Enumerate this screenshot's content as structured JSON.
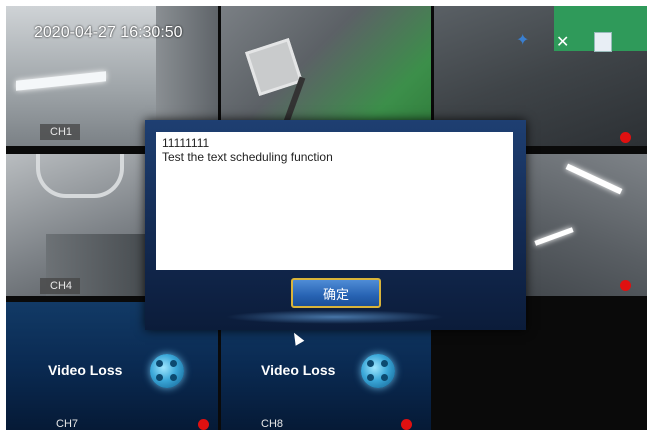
{
  "timestamp": "2020-04-27 16:30:50",
  "channels": {
    "ch1": "CH1",
    "ch4": "CH4",
    "ch7": "CH7",
    "ch8": "CH8"
  },
  "video_loss_text": "Video Loss",
  "dialog": {
    "line1": "11111111",
    "line2": "Test the text scheduling function",
    "ok_label": "确定"
  },
  "colors": {
    "record_dot": "#e01010",
    "dialog_bg": "#1e3f72",
    "button_border": "#d9b43a"
  }
}
